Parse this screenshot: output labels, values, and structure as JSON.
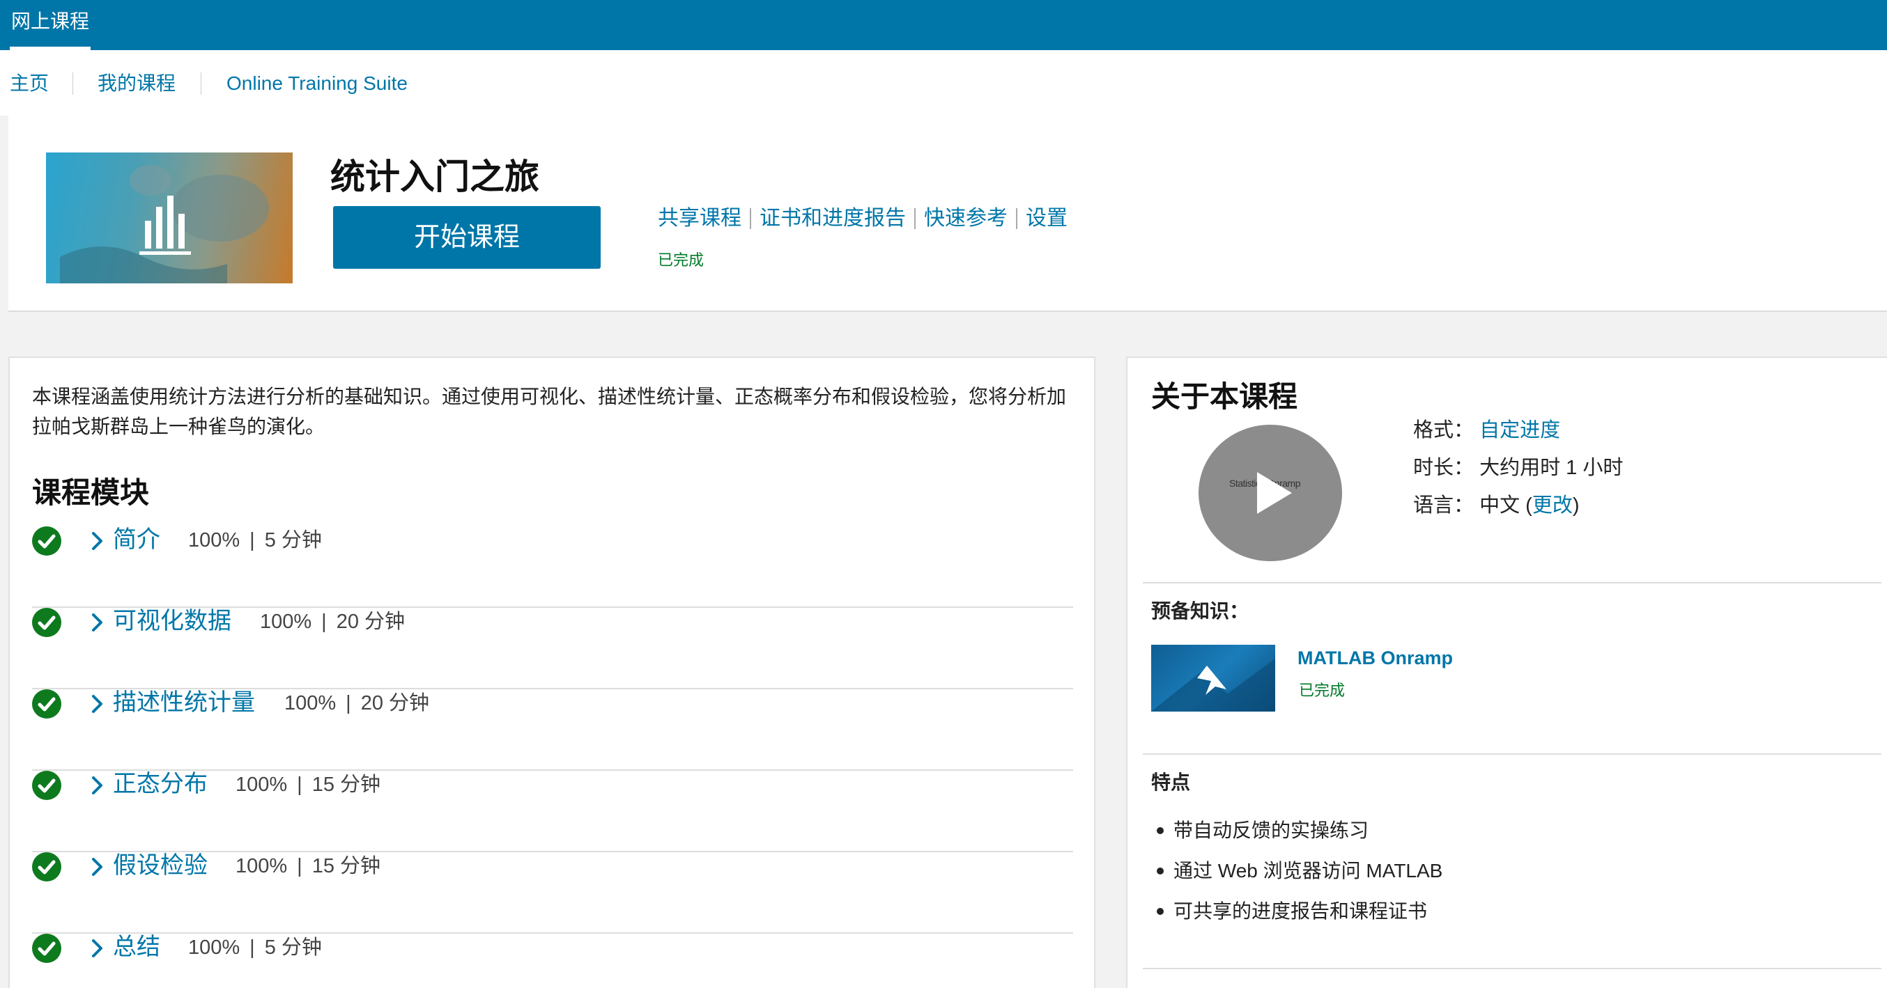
{
  "topbar": {
    "brand": "网上课程"
  },
  "subnav": {
    "items": [
      "主页",
      "我的课程",
      "Online Training Suite"
    ]
  },
  "course": {
    "title": "统计入门之旅",
    "start_button": "开始课程",
    "links": [
      "共享课程",
      "证书和进度报告",
      "快速参考",
      "设置"
    ],
    "status": "已完成"
  },
  "description": "本课程涵盖使用统计方法进行分析的基础知识。通过使用可视化、描述性统计量、正态概率分布和假设检验，您将分析加拉帕戈斯群岛上一种雀鸟的演化。",
  "modules": {
    "title": "课程模块",
    "items": [
      {
        "name": "简介",
        "progress": "100%",
        "duration": "5 分钟"
      },
      {
        "name": "可视化数据",
        "progress": "100%",
        "duration": "20 分钟"
      },
      {
        "name": "描述性统计量",
        "progress": "100%",
        "duration": "20 分钟"
      },
      {
        "name": "正态分布",
        "progress": "100%",
        "duration": "15 分钟"
      },
      {
        "name": "假设检验",
        "progress": "100%",
        "duration": "15 分钟"
      },
      {
        "name": "总结",
        "progress": "100%",
        "duration": "5 分钟"
      }
    ],
    "separator": "|"
  },
  "about": {
    "title": "关于本课程",
    "video_text": "Statistics Onramp",
    "format_label": "格式：",
    "format_value": "自定进度",
    "duration_label": "时长：",
    "duration_value": "大约用时 1 小时",
    "language_label": "语言：",
    "language_value": "中文",
    "language_change": "更改",
    "prereq_title": "预备知识：",
    "prereq_name": "MATLAB Onramp",
    "prereq_status": "已完成",
    "features_title": "特点",
    "features": [
      "带自动反馈的实操练习",
      "通过 Web 浏览器访问 MATLAB",
      "可共享的进度报告和课程证书"
    ]
  },
  "colors": {
    "brand": "#0076a8",
    "success": "#007a2a"
  },
  "icons": {
    "check": "check-circle-icon",
    "chevron": "chevron-right-icon",
    "play": "play-icon"
  }
}
